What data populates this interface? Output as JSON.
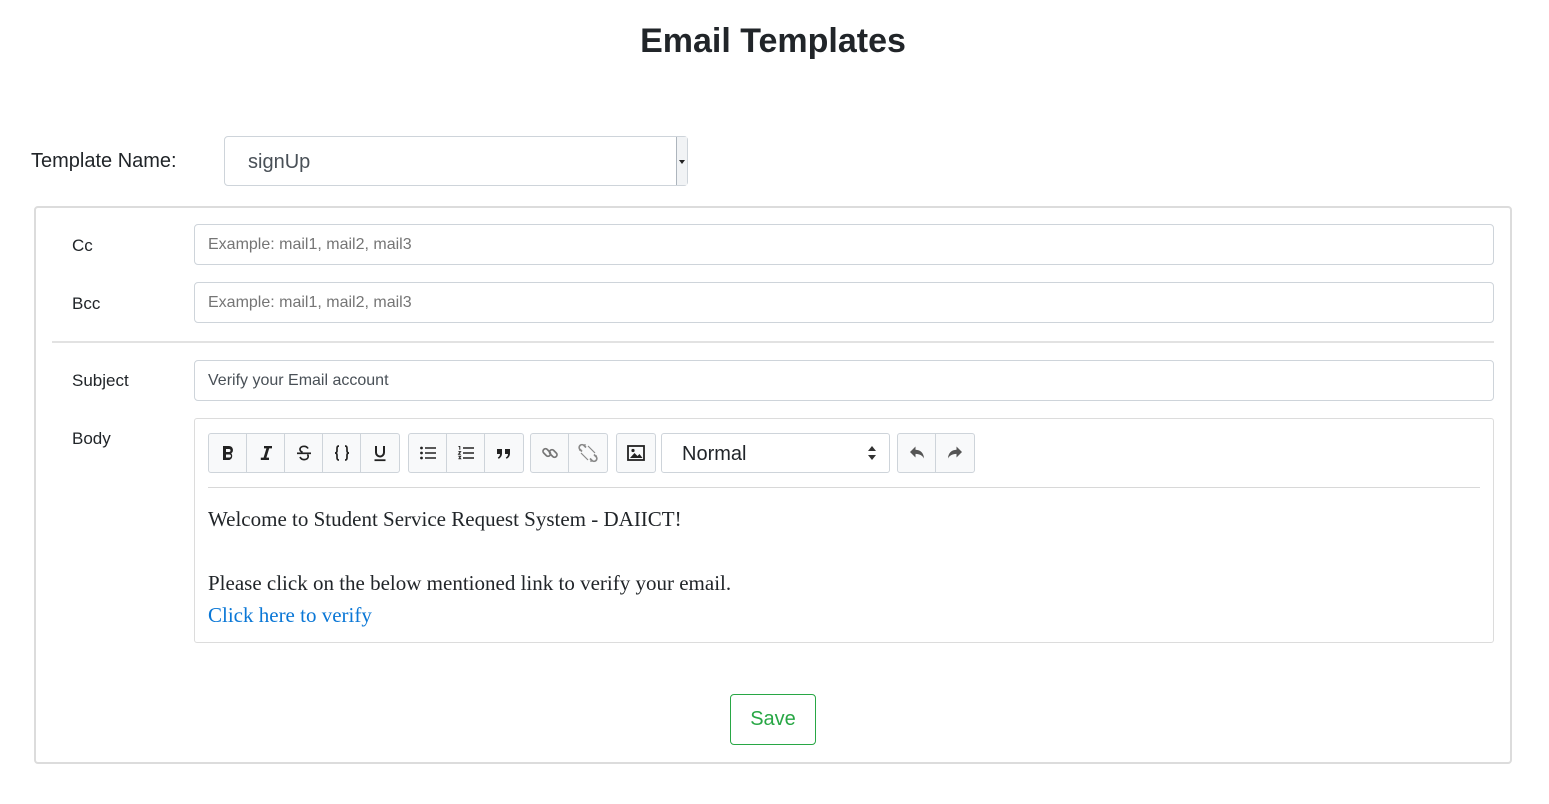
{
  "page": {
    "title": "Email Templates"
  },
  "template": {
    "label": "Template Name:",
    "selected": "signUp"
  },
  "form": {
    "cc": {
      "label": "Cc",
      "placeholder": "Example: mail1, mail2, mail3",
      "value": ""
    },
    "bcc": {
      "label": "Bcc",
      "placeholder": "Example: mail1, mail2, mail3",
      "value": ""
    },
    "subject": {
      "label": "Subject",
      "value": "Verify your Email account"
    },
    "body": {
      "label": "Body",
      "toolbar": {
        "groups": [
          [
            "bold-icon",
            "italic-icon",
            "strikethrough-icon",
            "code-icon",
            "underline-icon"
          ],
          [
            "bullet-list-icon",
            "numbered-list-icon",
            "blockquote-icon"
          ],
          [
            "link-icon",
            "unlink-icon"
          ],
          [
            "image-icon"
          ],
          [
            "undo-icon",
            "redo-icon"
          ]
        ],
        "format": "Normal"
      },
      "lines": {
        "welcome": "Welcome to Student Service Request System - DAIICT!",
        "instruction": "Please click on the below mentioned link to verify your email.",
        "link": "Click here to verify"
      }
    }
  },
  "actions": {
    "save_label": "Save"
  },
  "colors": {
    "accent": "#28a745",
    "link": "#0a77d6",
    "text": "#212529"
  }
}
